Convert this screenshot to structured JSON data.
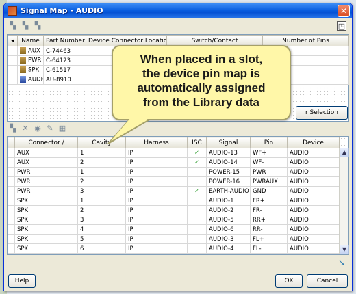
{
  "window": {
    "title": "Signal Map - AUDIO",
    "close_glyph": "✕"
  },
  "top_table": {
    "columns": [
      "Name",
      "Part Number",
      "Device Connector Location",
      "Switch/Contact",
      "Number of Pins"
    ],
    "rows": [
      {
        "name": "AUX",
        "part": "C-74463"
      },
      {
        "name": "PWR",
        "part": "C-64123"
      },
      {
        "name": "SPK",
        "part": "C-61517"
      },
      {
        "name": "AUDIO",
        "part": "AU-8910"
      }
    ]
  },
  "callout": {
    "lines": [
      "When placed in a slot,",
      "the device pin map is",
      "automatically assigned",
      "from the Library data"
    ]
  },
  "buttons": {
    "filter_selection": "r Selection",
    "help": "Help",
    "ok": "OK",
    "cancel": "Cancel"
  },
  "bottom_table": {
    "columns": [
      "Connector /",
      "Cavity",
      "Harness",
      "ISC",
      "Signal",
      "Pin",
      "Device"
    ],
    "rows": [
      {
        "connector": "AUX",
        "cavity": "1",
        "harness": "IP",
        "isc": "✓",
        "signal": "AUDIO-13",
        "pin": "WF+",
        "device": "AUDIO"
      },
      {
        "connector": "AUX",
        "cavity": "2",
        "harness": "IP",
        "isc": "✓",
        "signal": "AUDIO-14",
        "pin": "WF-",
        "device": "AUDIO"
      },
      {
        "connector": "PWR",
        "cavity": "1",
        "harness": "IP",
        "isc": "",
        "signal": "POWER-15",
        "pin": "PWR",
        "device": "AUDIO"
      },
      {
        "connector": "PWR",
        "cavity": "2",
        "harness": "IP",
        "isc": "",
        "signal": "POWER-16",
        "pin": "PWRAUX",
        "device": "AUDIO"
      },
      {
        "connector": "PWR",
        "cavity": "3",
        "harness": "IP",
        "isc": "✓",
        "signal": "EARTH-AUDIO",
        "pin": "GND",
        "device": "AUDIO"
      },
      {
        "connector": "SPK",
        "cavity": "1",
        "harness": "IP",
        "isc": "",
        "signal": "AUDIO-1",
        "pin": "FR+",
        "device": "AUDIO"
      },
      {
        "connector": "SPK",
        "cavity": "2",
        "harness": "IP",
        "isc": "",
        "signal": "AUDIO-2",
        "pin": "FR-",
        "device": "AUDIO"
      },
      {
        "connector": "SPK",
        "cavity": "3",
        "harness": "IP",
        "isc": "",
        "signal": "AUDIO-5",
        "pin": "RR+",
        "device": "AUDIO"
      },
      {
        "connector": "SPK",
        "cavity": "4",
        "harness": "IP",
        "isc": "",
        "signal": "AUDIO-6",
        "pin": "RR-",
        "device": "AUDIO"
      },
      {
        "connector": "SPK",
        "cavity": "5",
        "harness": "IP",
        "isc": "",
        "signal": "AUDIO-3",
        "pin": "FL+",
        "device": "AUDIO"
      },
      {
        "connector": "SPK",
        "cavity": "6",
        "harness": "IP",
        "isc": "",
        "signal": "AUDIO-4",
        "pin": "FL-",
        "device": "AUDIO"
      }
    ]
  },
  "colors": {
    "title_bar": "#0a5fe0",
    "callout_fill": "#fff7a8",
    "check": "#2a9a2a"
  }
}
